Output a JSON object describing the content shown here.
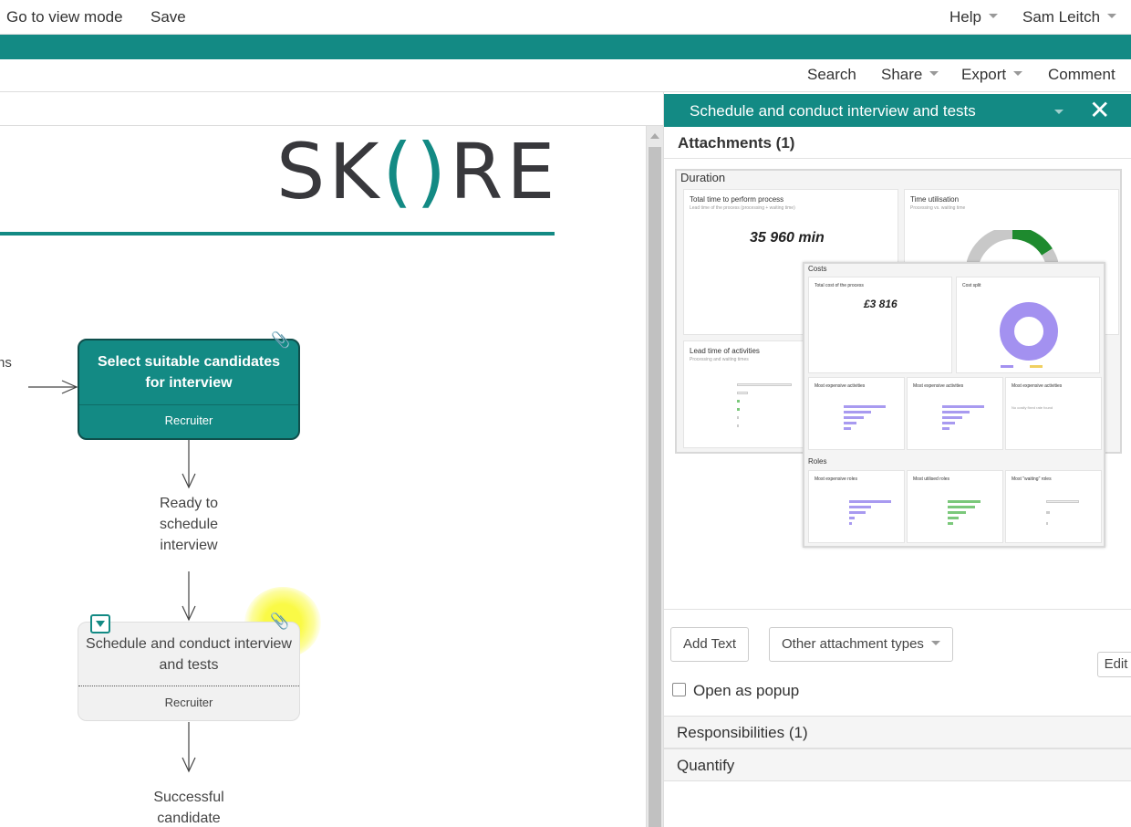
{
  "topbar": {
    "view_mode": "Go to view mode",
    "save": "Save",
    "help": "Help",
    "user": "Sam Leitch"
  },
  "actionbar": {
    "search": "Search",
    "share": "Share",
    "export": "Export",
    "comment": "Comment"
  },
  "canvas": {
    "logo_left": "SK",
    "logo_paren_open": "(",
    "logo_paren_close": ")",
    "logo_right": "RE",
    "side_text": "ns",
    "node1": {
      "title": "Select suitable candidates for interview",
      "role": "Recruiter"
    },
    "flow_text_1": "Ready to schedule interview",
    "node2": {
      "title": "Schedule and conduct interview and tests",
      "role": "Recruiter"
    },
    "flow_text_2": "Successful candidate"
  },
  "panel": {
    "title": "Schedule and conduct interview and tests",
    "close": "✕",
    "attachments_header": "Attachments (1)",
    "dashboard": {
      "duration_title": "Duration",
      "total_time_title": "Total time to perform process",
      "total_time_sub": "Lead time of the process (processing + waiting time)",
      "total_time_value": "35 960 min",
      "utilisation_title": "Time utilisation",
      "utilisation_sub": "Processing vs. waiting time",
      "lead_time_title": "Lead time of activities",
      "lead_time_sub": "Processing and waiting times",
      "costs_title": "Costs",
      "total_cost_title": "Total cost of the process",
      "total_cost_value": "£3 816",
      "cost_split_title": "Cost split",
      "exp1_title": "Most expensive activities",
      "exp2_title": "Most expensive activities",
      "exp3_title": "Most expensive activities",
      "exp3_note": "No costly fixed rate found",
      "roles_title": "Roles",
      "roles1_title": "Most expensive roles",
      "roles2_title": "Most utilised roles",
      "roles3_title": "Most \"waiting\" roles"
    },
    "edit": "Edit",
    "add_text": "Add Text",
    "other_types": "Other attachment types",
    "open_popup": "Open as popup",
    "responsibilities": "Responsibilities (1)",
    "quantify": "Quantify"
  },
  "colors": {
    "accent": "#138a84",
    "highlight": "#f5f53c",
    "donut_purple": "#a391f0",
    "donut_green": "#1e8a2e"
  }
}
